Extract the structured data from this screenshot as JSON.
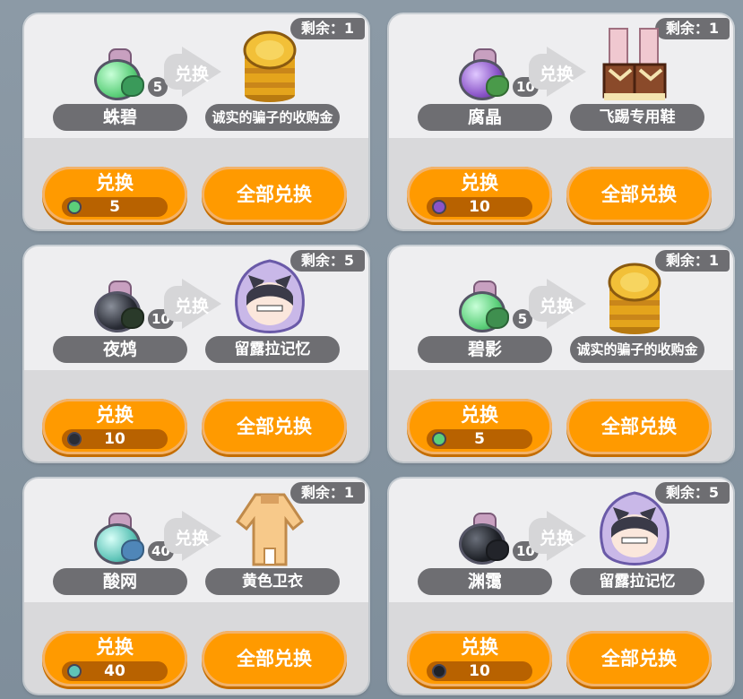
{
  "exchange_label": "兑换",
  "exchange_all_label": "全部兑换",
  "remaining_prefix": "剩余：",
  "colors": {
    "accent": "#ff9a00",
    "pill": "#6e6e72"
  },
  "cards": [
    {
      "remaining": "剩余：1",
      "input_name": "蛛碧",
      "input_count": "5",
      "output_name": "诚实的骗子的收购金",
      "cost": "5",
      "orb_color": "#5ccf7a",
      "leaf_color": "#3a9a5a",
      "reward_icon": "gold-coins-icon"
    },
    {
      "remaining": "剩余：1",
      "input_name": "腐晶",
      "input_count": "10",
      "output_name": "飞踢专用鞋",
      "cost": "10",
      "orb_color": "#8a54c8",
      "leaf_color": "#4a9a4a",
      "reward_icon": "boots-icon"
    },
    {
      "remaining": "剩余：5",
      "input_name": "夜鸩",
      "input_count": "10",
      "output_name": "留露拉记忆",
      "cost": "10",
      "orb_color": "#2a2d36",
      "leaf_color": "#2a3a2a",
      "reward_icon": "character-portrait-icon"
    },
    {
      "remaining": "剩余：1",
      "input_name": "碧影",
      "input_count": "5",
      "output_name": "诚实的骗子的收购金",
      "cost": "5",
      "orb_color": "#5ccf7a",
      "leaf_color": "#3f8f4f",
      "reward_icon": "gold-coins-icon"
    },
    {
      "remaining": "剩余：1",
      "input_name": "酸网",
      "input_count": "40",
      "output_name": "黄色卫衣",
      "cost": "40",
      "orb_color": "#5fc4b8",
      "leaf_color": "#4f86b8",
      "reward_icon": "yellow-hoodie-icon"
    },
    {
      "remaining": "剩余：5",
      "input_name": "渊霭",
      "input_count": "10",
      "output_name": "留露拉记忆",
      "cost": "10",
      "orb_color": "#1f2228",
      "leaf_color": "#22242a",
      "reward_icon": "character-portrait-icon"
    }
  ]
}
